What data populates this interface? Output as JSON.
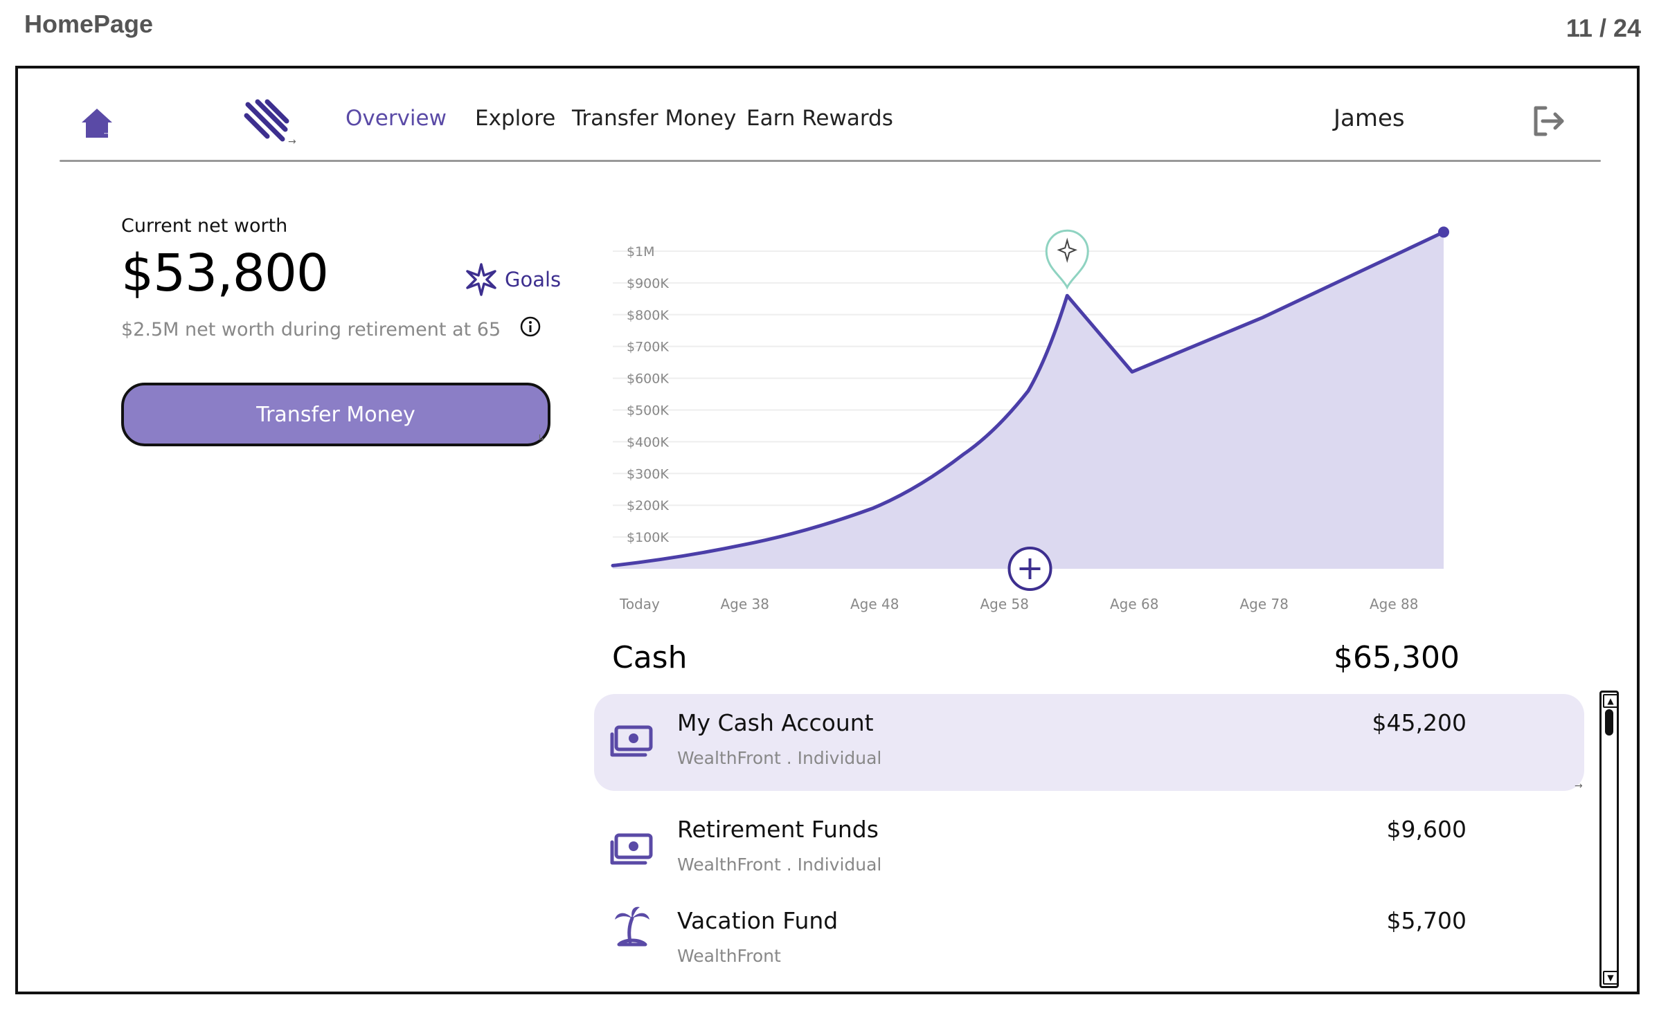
{
  "page": {
    "title": "HomePage",
    "counter": "11 / 24"
  },
  "nav": {
    "home_icon": "house-icon",
    "logo_icon": "striped-logo-icon",
    "links": [
      "Overview",
      "Explore",
      "Transfer Money",
      "Earn Rewards"
    ],
    "active": "Overview",
    "user": "James",
    "logout_icon": "logout-icon"
  },
  "summary": {
    "net_worth_label": "Current net worth",
    "net_worth_value": "$53,800",
    "retirement_text": "$2.5M net worth during retirement at 65",
    "goals_label": "Goals",
    "goals_icon": "sparkle-icon",
    "info_icon": "info-icon",
    "transfer_button": "Transfer Money"
  },
  "colors": {
    "accent": "#5a4aa6",
    "line": "#4b3ea8",
    "area": "#dcd9f0",
    "button": "#8b7ec6",
    "selected_row": "#ebe8f6",
    "goal_pin": "#8fd3c1"
  },
  "chart_data": {
    "type": "area",
    "x": [
      "Today",
      "Age 38",
      "Age 48",
      "Age 58",
      "Age 68",
      "Age 78",
      "Age 88"
    ],
    "y_ticks": [
      "$100K",
      "$200K",
      "$300K",
      "$400K",
      "$500K",
      "$600K",
      "$700K",
      "$800K",
      "$900K",
      "$1M"
    ],
    "ylim": [
      0,
      1050000
    ],
    "points": [
      {
        "age": 28,
        "value": 10000
      },
      {
        "age": 38,
        "value": 75000
      },
      {
        "age": 48,
        "value": 190000
      },
      {
        "age": 55,
        "value": 360000
      },
      {
        "age": 60,
        "value": 560000
      },
      {
        "age": 63,
        "value": 860000
      },
      {
        "age": 68,
        "value": 620000
      },
      {
        "age": 78,
        "value": 790000
      },
      {
        "age": 92,
        "value": 1060000
      }
    ],
    "markers": [
      {
        "type": "goal-pin",
        "icon": "sparkle-icon",
        "age": 63
      },
      {
        "type": "add-button",
        "icon": "plus-circle-icon",
        "age": 58
      }
    ],
    "grid": true,
    "legend": "none"
  },
  "cash": {
    "title": "Cash",
    "total": "$65,300",
    "accounts": [
      {
        "name": "My Cash Account",
        "sub": "WealthFront . Individual",
        "amount": "$45,200",
        "icon": "cash-stack-icon",
        "selected": true
      },
      {
        "name": "Retirement Funds",
        "sub": "WealthFront . Individual",
        "amount": "$9,600",
        "icon": "cash-stack-icon",
        "selected": false
      },
      {
        "name": "Vacation Fund",
        "sub": "WealthFront",
        "amount": "$5,700",
        "icon": "palm-tree-icon",
        "selected": false
      }
    ]
  }
}
